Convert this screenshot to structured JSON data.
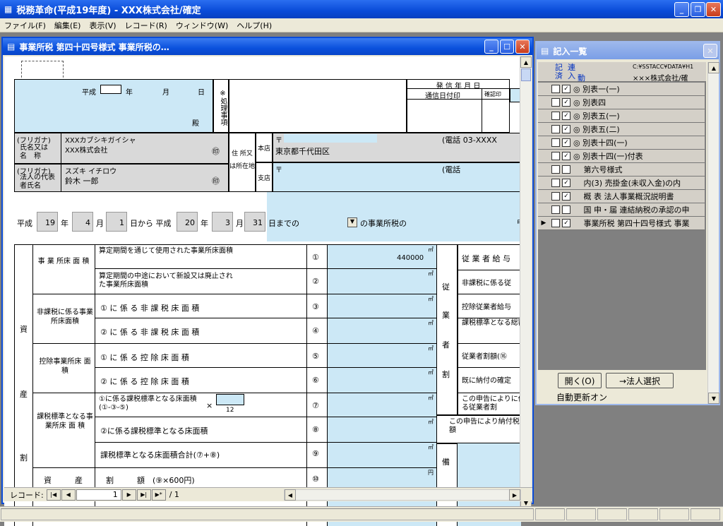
{
  "app": {
    "title": "税務革命(平成19年度) - XXX株式会社/確定"
  },
  "menu": [
    "ファイル(F)",
    "編集(E)",
    "表示(V)",
    "レコード(R)",
    "ウィンドウ(W)",
    "ヘルプ(H)"
  ],
  "form_window": {
    "title": "事業所税 第四十四号様式 事業所税の…"
  },
  "header": {
    "heisei": "平成",
    "year": "年",
    "month": "月",
    "day": "日",
    "dono": "殿",
    "shori": "※処理事項",
    "hasshin": "発 信 年 月 日",
    "tsushin": "通信日付印",
    "kakunin": "確認印"
  },
  "company": {
    "furigana_label": "(フリガナ)",
    "name_label": "氏名又は名　称",
    "furigana": "XXXカブシキガイシャ",
    "name": "XXX株式会社",
    "seal": "㊞",
    "rep_furigana_label": "(フリガナ)",
    "rep_label": "法人の代表者氏名",
    "rep_furigana": "スズキ イチロウ",
    "rep_name": "鈴木 一郎",
    "addr_label": "住 所又は所在地",
    "honten": "本店",
    "shiten": "支店",
    "postal": "〒",
    "address": "東京都千代田区",
    "tel1": "(電話 03-XXXX",
    "tel2": "(電話"
  },
  "period": {
    "heisei": "平成",
    "from_year": "19",
    "year": "年",
    "from_month": "4",
    "month": "月",
    "from_day": "1",
    "from_text": "日から 平成",
    "to_year": "20",
    "to_month": "3",
    "to_day": "31",
    "to_text": "日までの",
    "suffix": "の事業所税の",
    "edge": "申"
  },
  "table": {
    "shisan": "資",
    "san": "産",
    "wari": "割",
    "g1": "事 業 所床 面 積",
    "g2": "非課税に係る事業所床面積",
    "g3": "控除事業所床 面 積",
    "g4": "課税標準となる事業所床 面 積",
    "r1": "算定期間を通じて使用された事業所床面積",
    "r2": "算定期間の中途において新設又は廃止された事業所床面積",
    "r3": "① に 係 る 非 課 税 床 面 積",
    "r4": "② に 係 る 非 課 税 床 面 積",
    "r5": "① に 係 る 控 除 床 面 積",
    "r6": "② に 係 る 控 除 床 面 積",
    "r7": "①に係る課税標準となる床面積(①-③-⑤)",
    "r7_x": "×",
    "r7_den": "12",
    "r8": "②に係る課税標準となる床面積",
    "r9": "課税標準となる床面積合計(⑦+⑧)",
    "r10": "資　　　産　　　割　　　額　(⑨×600円)",
    "n1": "①",
    "n2": "②",
    "n3": "③",
    "n4": "④",
    "n5": "⑤",
    "n6": "⑥",
    "n7": "⑦",
    "n8": "⑧",
    "n9": "⑨",
    "n10": "⑩",
    "unit": "㎡",
    "yen": "円",
    "v1": "440000",
    "ju": "従",
    "gyo": "業",
    "sha": "者",
    "kwari": "割",
    "rr1": "従 業 者 給 与",
    "rr2": "非課税に係る従",
    "rr3": "控除従業者給与",
    "rr4": "課税標準となる総額",
    "rr5": "従業者割額(⑯",
    "rr6": "既に納付の確定",
    "rr7": "この申告によりに係る従業者割",
    "rr8": "この申告により納付税額",
    "bi": "備"
  },
  "nav": {
    "label": "レコード:",
    "current": "1",
    "total": "/ 1"
  },
  "list_window": {
    "title": "記入一覧",
    "col1": "記 済",
    "col2": "連入",
    "col3": "動",
    "path": "C:¥SSTACC¥DATA¥H1",
    "company": "×××株式会社/確",
    "items": [
      {
        "c1": "☐",
        "c2": "☑",
        "label": "◎ 別表一(一)"
      },
      {
        "c1": "☐",
        "c2": "☑",
        "label": "◎ 別表四"
      },
      {
        "c1": "☐",
        "c2": "☑",
        "label": "◎ 別表五(一)"
      },
      {
        "c1": "☐",
        "c2": "☑",
        "label": "◎ 別表五(二)"
      },
      {
        "c1": "☐",
        "c2": "☑",
        "label": "◎ 別表十四(一)"
      },
      {
        "c1": "☐",
        "c2": "☑",
        "label": "◎ 別表十四(一)付表"
      },
      {
        "c1": "☐",
        "c2": "☐",
        "label": "　 第六号様式"
      },
      {
        "c1": "☐",
        "c2": "☑",
        "label": "　 内(3) 売掛金(未収入金)の内"
      },
      {
        "c1": "☐",
        "c2": "☑",
        "label": "　 概 表 法人事業概況説明書"
      },
      {
        "c1": "☐",
        "c2": "☐",
        "label": "　 国 申・届 連結納税の承認の申"
      },
      {
        "c1": "☐",
        "c2": "☑",
        "label": "　 事業所税 第四十四号様式 事業"
      }
    ],
    "open_btn": "開く(O)",
    "select_btn": "→法人選択",
    "auto": "自動更新オン"
  }
}
